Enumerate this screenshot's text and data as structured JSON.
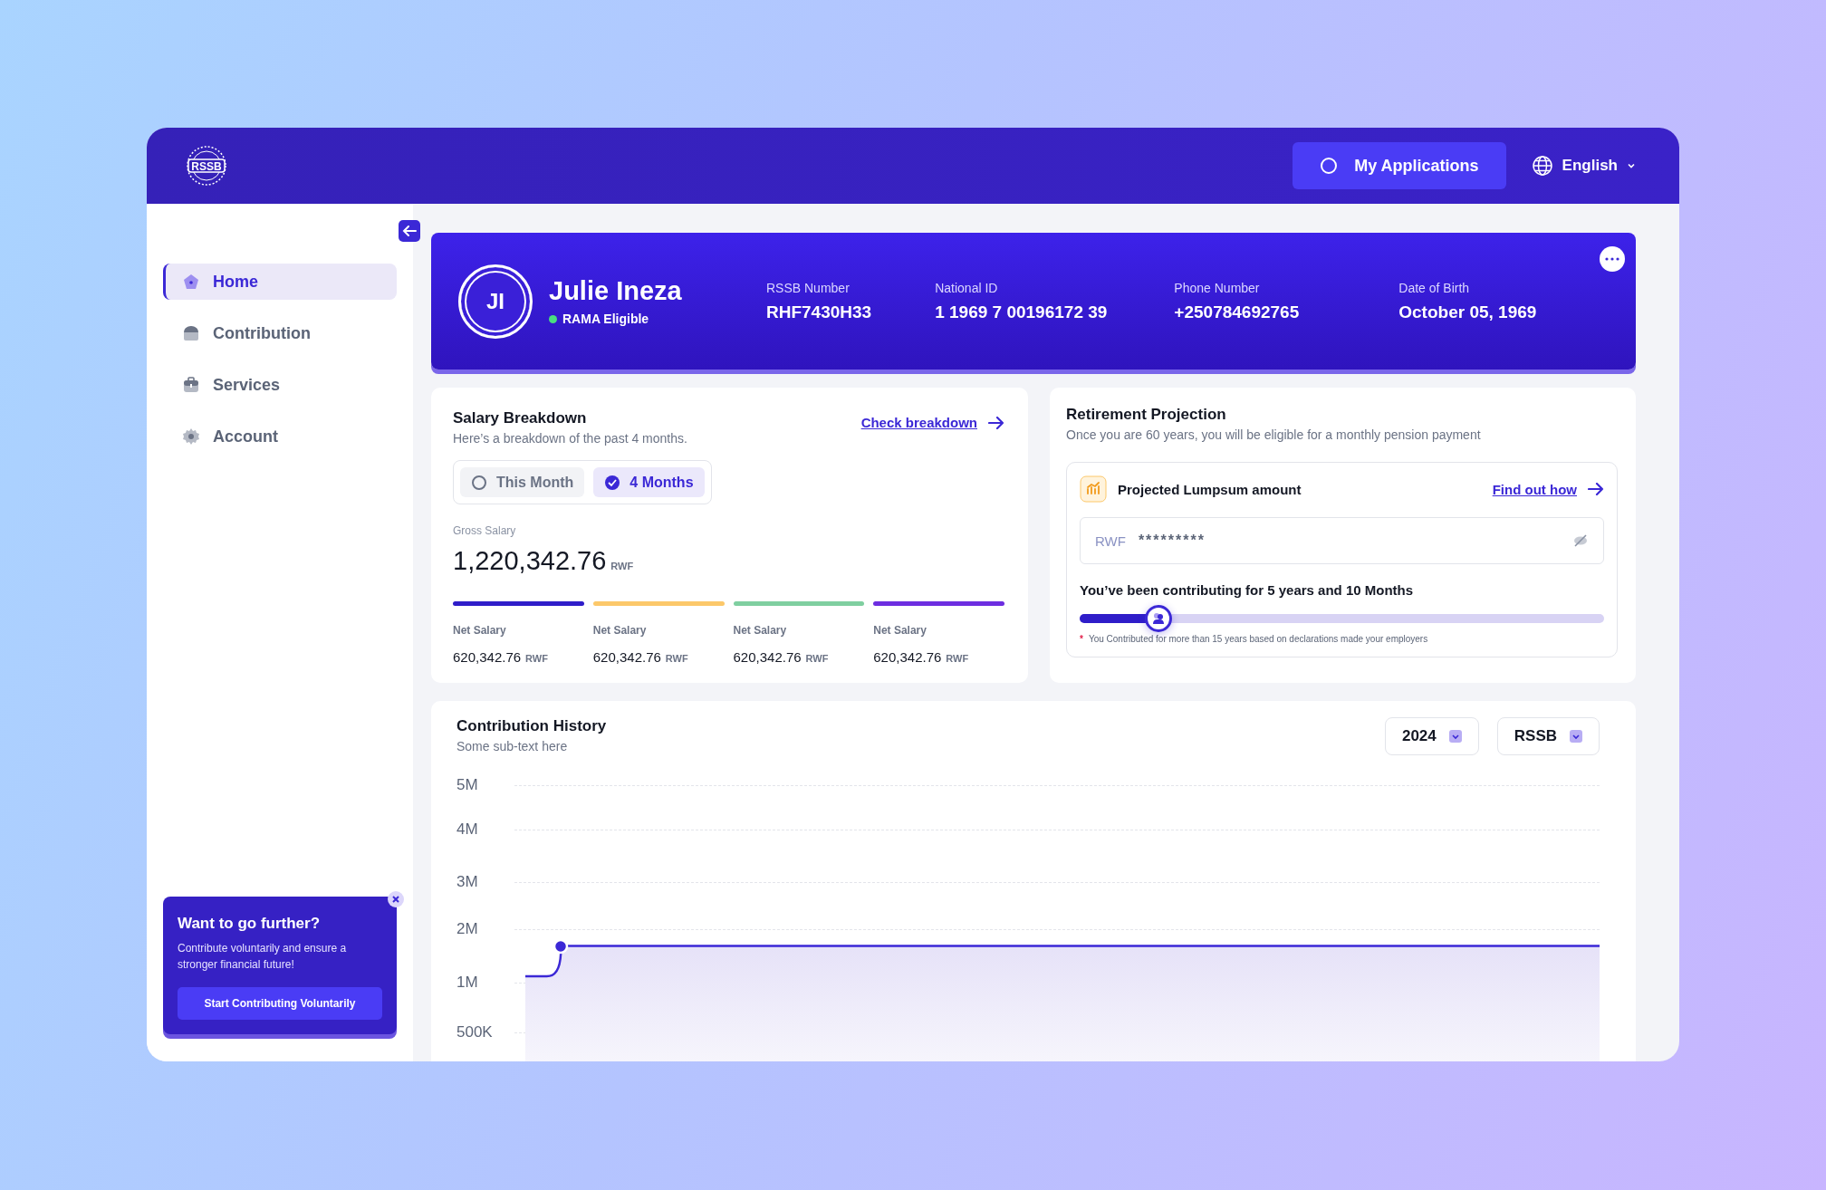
{
  "header": {
    "logo_text": "RSSB",
    "applications_button": "My Applications",
    "language": "English"
  },
  "sidebar": {
    "items": [
      {
        "label": "Home",
        "selected": true
      },
      {
        "label": "Contribution",
        "selected": false
      },
      {
        "label": "Services",
        "selected": false
      },
      {
        "label": "Account",
        "selected": false
      }
    ],
    "promo": {
      "title": "Want to go further?",
      "text": "Contribute voluntarily and ensure a stronger financial future!",
      "button": "Start Contributing Voluntarily"
    }
  },
  "profile": {
    "initials": "JI",
    "name": "Julie Ineza",
    "status": "RAMA Eligible",
    "fields": [
      {
        "label": "RSSB Number",
        "value": "RHF7430H33"
      },
      {
        "label": "National ID",
        "value": "1 1969 7 00196172 39"
      },
      {
        "label": "Phone Number",
        "value": "+250784692765"
      },
      {
        "label": "Date of Birth",
        "value": "October 05, 1969"
      }
    ]
  },
  "salary": {
    "title": "Salary Breakdown",
    "subtitle": "Here’s a breakdown of the past 4 months.",
    "link": "Check breakdown",
    "periods": [
      {
        "label": "This Month",
        "selected": false
      },
      {
        "label": "4 Months",
        "selected": true
      }
    ],
    "gross_label": "Gross Salary",
    "gross_value": "1,220,342.76",
    "currency": "RWF",
    "months": [
      {
        "label": "Net Salary",
        "value": "620,342.76",
        "currency": "RWF",
        "color": "#2f1dc9"
      },
      {
        "label": "Net Salary",
        "value": "620,342.76",
        "currency": "RWF",
        "color": "#fcc86a"
      },
      {
        "label": "Net Salary",
        "value": "620,342.76",
        "currency": "RWF",
        "color": "#7fcfa0"
      },
      {
        "label": "Net Salary",
        "value": "620,342.76",
        "currency": "RWF",
        "color": "#6d2ee0"
      }
    ]
  },
  "retirement": {
    "title": "Retirement Projection",
    "subtitle": "Once you are 60 years, you will be eligible for a monthly pension payment",
    "lumpsum_label": "Projected Lumpsum amount",
    "link": "Find out how",
    "currency": "RWF",
    "masked_value": "*********",
    "contributing_text": "You’ve been contributing for 5 years and 10 Months",
    "level": 0.15,
    "note_mark": "*",
    "note": "You Contributed for more than 15 years based on declarations made your employers"
  },
  "history": {
    "title": "Contribution History",
    "subtitle": "Some sub-text here",
    "filters": [
      {
        "value": "2024"
      },
      {
        "value": "RSSB"
      }
    ],
    "y_axis_labels": [
      "5M",
      "4M",
      "3M",
      "2M",
      "1M",
      "500K"
    ]
  }
}
